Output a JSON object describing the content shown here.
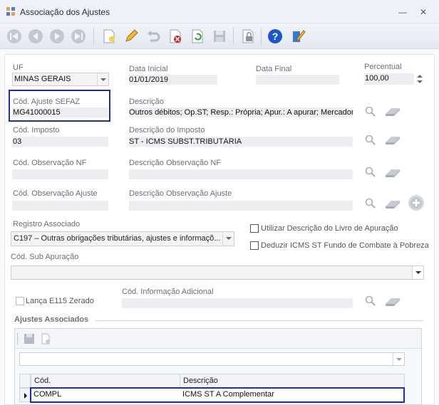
{
  "window": {
    "title": "Associação dos Ajustes",
    "minimize": "—",
    "close": "✕"
  },
  "toolbar": {
    "buttons": [
      "first-record",
      "previous-record",
      "next-record",
      "last-record",
      "new-document",
      "edit-pencil",
      "undo",
      "delete",
      "refresh",
      "save-disk",
      "lock",
      "help",
      "pencil-edit"
    ]
  },
  "form": {
    "uf": {
      "label": "UF",
      "value": "MINAS GERAIS"
    },
    "data_inicial": {
      "label": "Data Inicial",
      "value": "01/01/2019"
    },
    "data_final": {
      "label": "Data Final",
      "value": ""
    },
    "percentual": {
      "label": "Percentual",
      "value": "100,00"
    },
    "cod_ajuste": {
      "label": "Cód. Ajuste SEFAZ",
      "value": "MG41000015"
    },
    "descricao": {
      "label": "Descrição",
      "value": "Outros débitos; Op.ST; Resp.: Própria; Apur.: A apurar; Mercadoria"
    },
    "cod_imposto": {
      "label": "Cód. Imposto",
      "value": "03"
    },
    "desc_imposto": {
      "label": "Descrição do Imposto",
      "value": "ST - ICMS SUBST.TRIBUTÁRIA"
    },
    "cod_obs_nf": {
      "label": "Cód. Observação NF",
      "value": ""
    },
    "desc_obs_nf": {
      "label": "Descrição Observação NF",
      "value": ""
    },
    "cod_obs_ajuste": {
      "label": "Cód. Observação Ajuste",
      "value": ""
    },
    "desc_obs_ajuste": {
      "label": "Descrição Observação Ajuste",
      "value": ""
    },
    "registro": {
      "label": "Registro Associado",
      "value": "C197 – Outras obrigações tributárias, ajustes e informaçõ..."
    },
    "utilizar_desc": {
      "label": "Utilizar Descrição do Livro de Apuração",
      "checked": false
    },
    "deduzir_icms": {
      "label": "Deduzir ICMS ST Fundo de Combate à Pobreza",
      "checked": false
    },
    "sub_apuracao": {
      "label": "Cód. Sub Apuração",
      "value": ""
    },
    "lanca_e115": {
      "label": "Lança E115 Zerado",
      "checked": false
    },
    "cod_info_adic": {
      "label": "Cód. Informação Adicional",
      "value": ""
    }
  },
  "ajustes": {
    "title": "Ajustes Associados",
    "columns": [
      "Cód.",
      "Descrição"
    ],
    "rows": [
      {
        "cod": "COMPL",
        "descricao": "ICMS ST A Complementar"
      }
    ]
  },
  "colors": {
    "highlight": "#1f2f9c",
    "help_blue": "#1e56c8",
    "delete_red": "#d42020"
  }
}
